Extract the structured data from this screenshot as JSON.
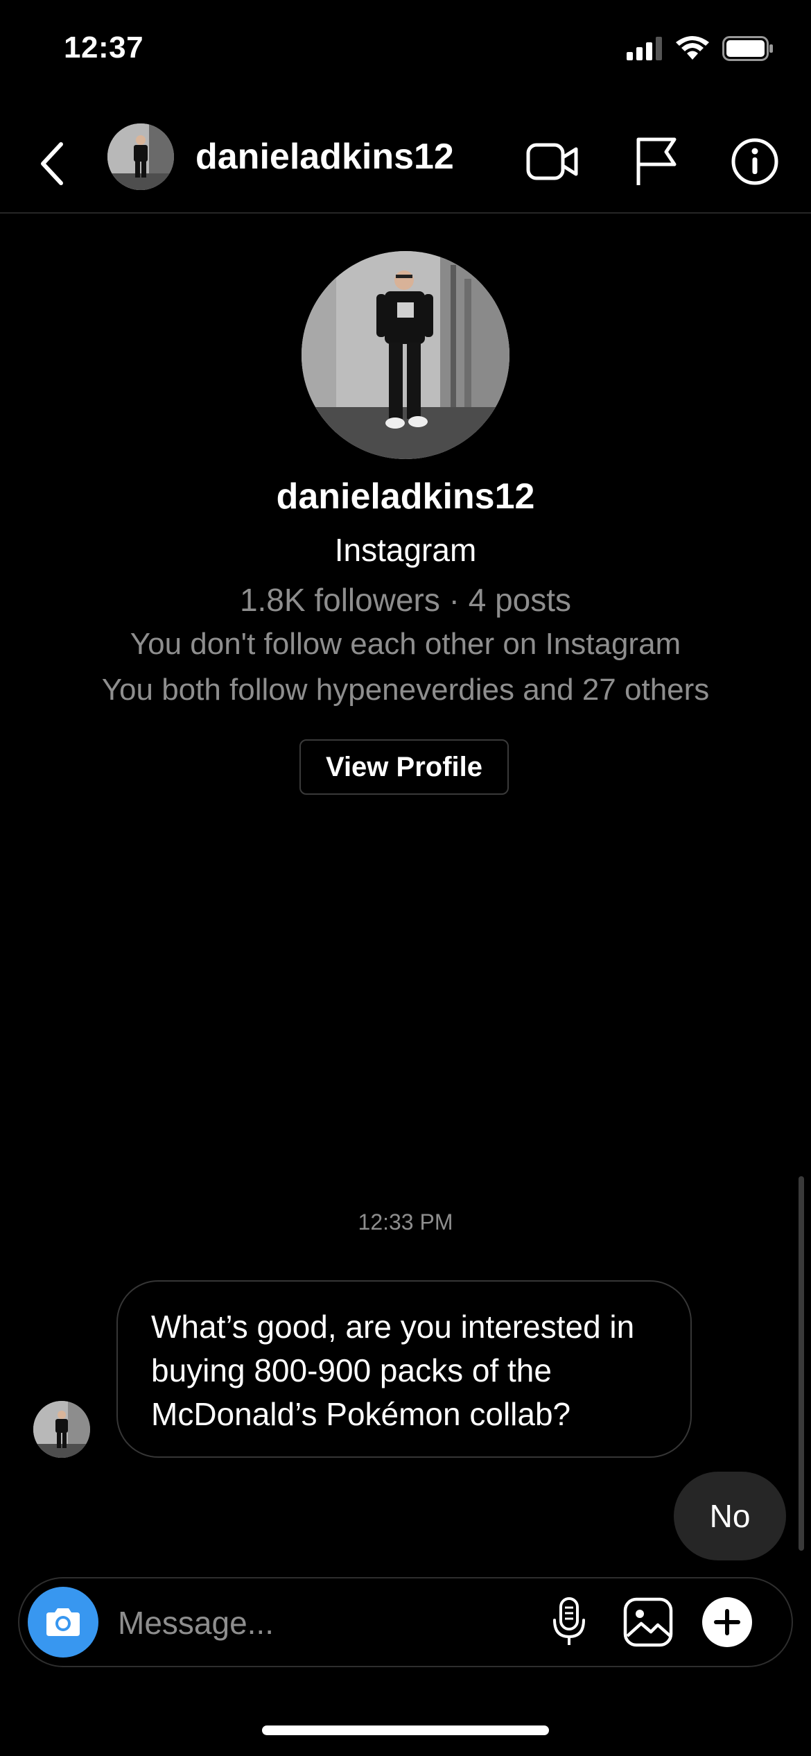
{
  "status_bar": {
    "time": "12:37",
    "icons": [
      "signal-icon",
      "wifi-icon",
      "battery-icon"
    ]
  },
  "header": {
    "username": "danieladkins12",
    "icons": [
      "back-icon",
      "video-call-icon",
      "flag-icon",
      "info-icon"
    ]
  },
  "profile": {
    "username": "danieladkins12",
    "platform": "Instagram",
    "stats": "1.8K followers · 4 posts",
    "follow_status": "You don't follow each other on Instagram",
    "mutuals": "You both follow hypeneverdies and 27 others",
    "view_profile_label": "View Profile"
  },
  "chat": {
    "timestamp": "12:33 PM",
    "messages": [
      {
        "direction": "incoming",
        "text": "What’s good, are you interested in buying 800-900 packs of the McDonald’s Pokémon collab?"
      },
      {
        "direction": "outgoing",
        "text": "No"
      }
    ]
  },
  "composer": {
    "placeholder": "Message...",
    "icons": [
      "camera-icon",
      "microphone-icon",
      "gallery-icon",
      "plus-icon"
    ]
  },
  "colors": {
    "background": "#000000",
    "secondary_text": "#8e8e8e",
    "camera_button": "#3897f0",
    "outgoing_bubble": "#262626",
    "border": "#363636"
  }
}
